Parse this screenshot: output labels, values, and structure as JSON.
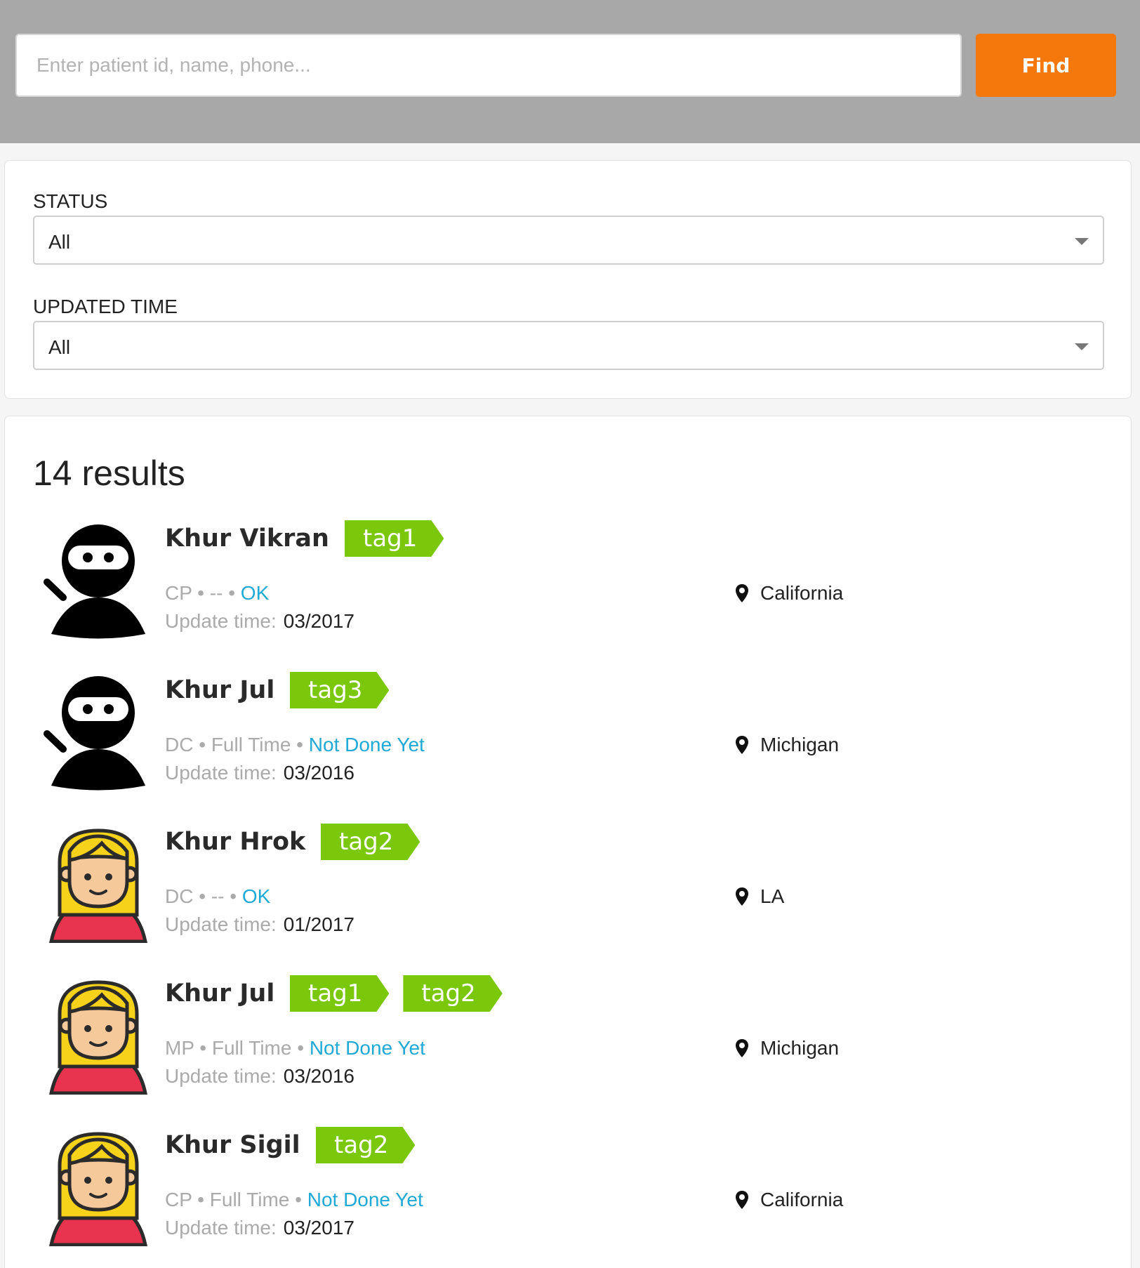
{
  "search": {
    "placeholder": "Enter patient id, name, phone...",
    "value": "",
    "button_label": "Find",
    "button_color": "#f4780b"
  },
  "filters": {
    "status": {
      "label": "STATUS",
      "selected": "All"
    },
    "updated_time": {
      "label": "UPDATED TIME",
      "selected": "All"
    }
  },
  "results": {
    "count_text": "14 results",
    "update_label": "Update time:",
    "tag_color": "#7ac70c",
    "status_color": "#1fa9d6",
    "patients": [
      {
        "name": "Khur Vikran",
        "avatar": "ninja-icon",
        "tags": [
          "tag1"
        ],
        "type": "CP",
        "sep1": " • ",
        "schedule": "--",
        "sep2": " • ",
        "status": "OK",
        "update_time": "03/2017",
        "location": "California"
      },
      {
        "name": "Khur Jul",
        "avatar": "ninja-icon",
        "tags": [
          "tag3"
        ],
        "type": "DC",
        "sep1": " • ",
        "schedule": "Full Time",
        "sep2": " • ",
        "status": "Not Done Yet",
        "update_time": "03/2016",
        "location": "Michigan"
      },
      {
        "name": "Khur Hrok",
        "avatar": "blonde-person-icon",
        "tags": [
          "tag2"
        ],
        "type": "DC",
        "sep1": " • ",
        "schedule": "--",
        "sep2": " • ",
        "status": "OK",
        "update_time": "01/2017",
        "location": "LA"
      },
      {
        "name": "Khur Jul",
        "avatar": "blonde-person-icon",
        "tags": [
          "tag1",
          "tag2"
        ],
        "type": "MP",
        "sep1": " • ",
        "schedule": "Full Time",
        "sep2": " • ",
        "status": "Not Done Yet",
        "update_time": "03/2016",
        "location": "Michigan"
      },
      {
        "name": "Khur Sigil",
        "avatar": "blonde-person-icon",
        "tags": [
          "tag2"
        ],
        "type": "CP",
        "sep1": " • ",
        "schedule": "Full Time",
        "sep2": " • ",
        "status": "Not Done Yet",
        "update_time": "03/2017",
        "location": "California"
      }
    ]
  }
}
